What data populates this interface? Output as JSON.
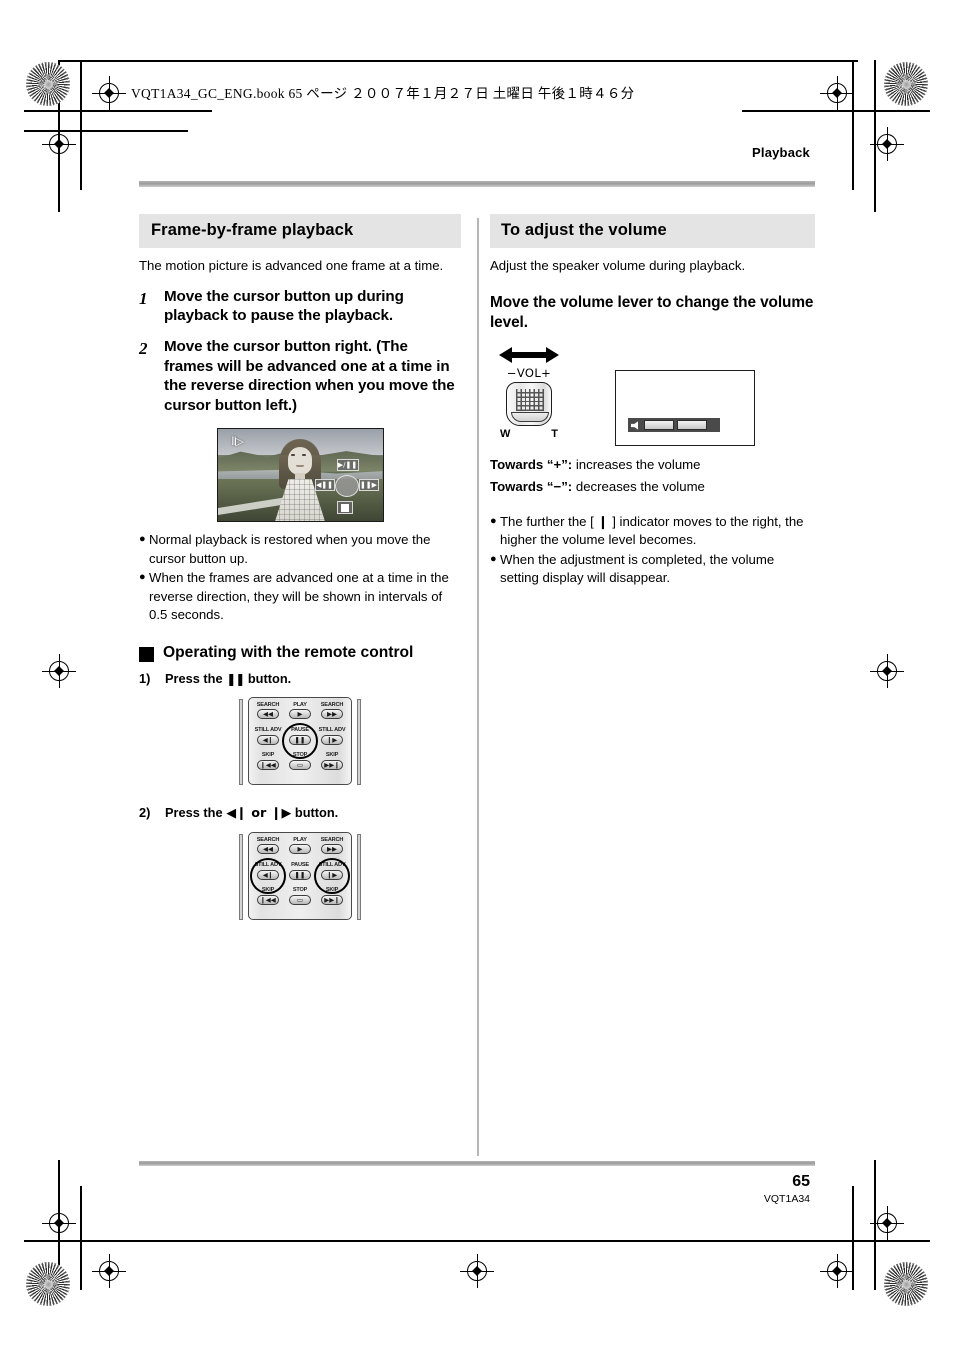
{
  "header": {
    "jp_line": "VQT1A34_GC_ENG.book   65 ページ   ２００７年１月２７日   土曜日   午後１時４６分",
    "running_head": "Playback"
  },
  "left_column": {
    "section_title": "Frame-by-frame playback",
    "lead": "The motion picture is advanced one frame at a time.",
    "steps": [
      {
        "num": "1",
        "text": "Move the cursor button up during playback to pause the playback."
      },
      {
        "num": "2",
        "text": "Move the cursor button right. (The frames will be advanced one at a time in the reverse direction when you move the cursor button left.)"
      }
    ],
    "lcd": {
      "osd_mode": "⦀▷",
      "controls": {
        "top": "▶/❚❚",
        "left": "◀❚❚",
        "right": "❚❚▶",
        "bottom": "stop-square"
      }
    },
    "bullets": [
      "Normal playback is restored when you move the cursor button up.",
      "When the frames are advanced one at a time in the reverse direction, they will be shown in intervals of 0.5 seconds."
    ],
    "remote_heading": "Operating with the remote control",
    "remote_steps": [
      {
        "num": "1)",
        "pre": "Press the ",
        "glyph": "❚❚",
        "post": " button."
      },
      {
        "num": "2)",
        "pre": "Press the ",
        "glyph": "◀❙ or ❙▶",
        "post": " button."
      }
    ],
    "remote_keys": [
      {
        "label": "SEARCH",
        "glyph": "◀◀"
      },
      {
        "label": "PLAY",
        "glyph": "▶"
      },
      {
        "label": "SEARCH",
        "glyph": "▶▶"
      },
      {
        "label": "STILL ADV",
        "glyph": "◀❙"
      },
      {
        "label": "PAUSE",
        "glyph": "❚❚"
      },
      {
        "label": "STILL ADV",
        "glyph": "❙▶"
      },
      {
        "label": "SKIP",
        "glyph": "❙◀◀"
      },
      {
        "label": "STOP",
        "glyph": "▭"
      },
      {
        "label": "SKIP",
        "glyph": "▶▶❙"
      }
    ]
  },
  "right_column": {
    "section_title": "To adjust the volume",
    "lead": "Adjust the speaker volume during playback.",
    "instruction": "Move the volume lever to change the volume level.",
    "lever": {
      "vol_label": "−VOL+",
      "wide_label": "W",
      "tele_label": "T"
    },
    "towards": [
      {
        "bold": "Towards “+”:",
        "rest": " increases the volume"
      },
      {
        "bold": "Towards “−”:",
        "rest": " decreases the volume"
      }
    ],
    "bullets": [
      "The further the [ ❙ ] indicator moves to the right, the higher the volume level becomes.",
      "When the adjustment is completed, the volume setting display will disappear."
    ]
  },
  "footer": {
    "page_number": "65",
    "doc_id": "VQT1A34"
  },
  "colors": {
    "section_header_bg": "#e4e4e4",
    "rule": "#9b9b9b",
    "divider": "#b6b6b6"
  }
}
